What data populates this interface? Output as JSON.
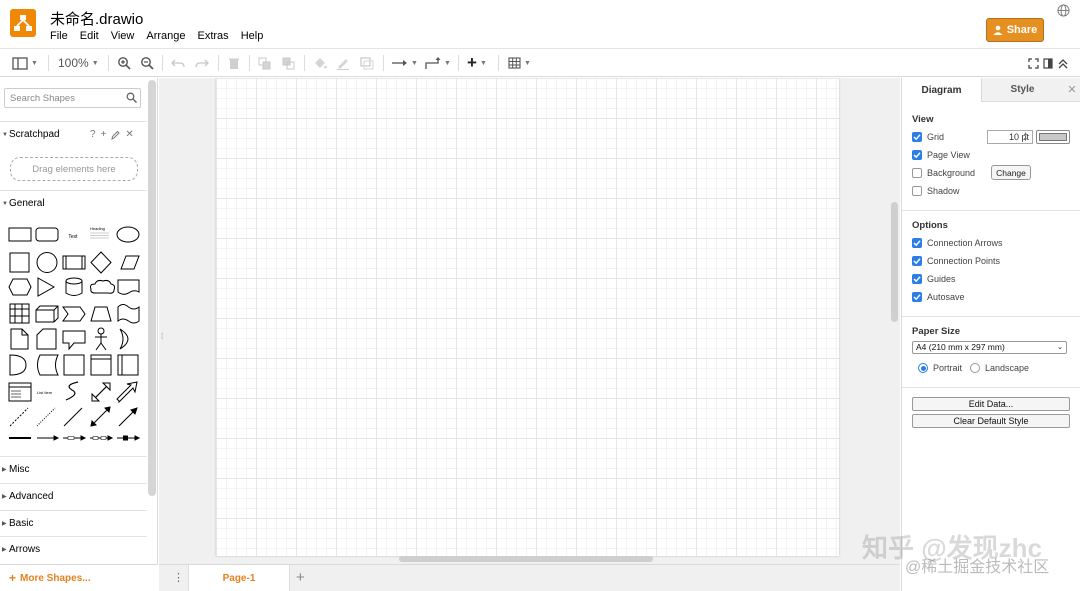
{
  "header": {
    "doc_title": "未命名.drawio",
    "menus": [
      "File",
      "Edit",
      "View",
      "Arrange",
      "Extras",
      "Help"
    ],
    "share_label": "Share"
  },
  "toolbar": {
    "zoom": "100%"
  },
  "left_panel": {
    "search_placeholder": "Search Shapes",
    "scratchpad_title": "Scratchpad",
    "scratchpad_help": "?",
    "dropzone_text": "Drag elements here",
    "general_title": "General",
    "shape_text_label": "Text",
    "shape_heading_label": "Heading",
    "shape_list_label": "List Item",
    "sections": [
      "Misc",
      "Advanced",
      "Basic",
      "Arrows"
    ],
    "more_shapes_label": "More Shapes..."
  },
  "page_tabs": {
    "current": "Page-1"
  },
  "right_panel": {
    "tabs": [
      "Diagram",
      "Style"
    ],
    "view_title": "View",
    "view_options": [
      {
        "label": "Grid",
        "checked": true
      },
      {
        "label": "Page View",
        "checked": true
      },
      {
        "label": "Background",
        "checked": false
      },
      {
        "label": "Shadow",
        "checked": false
      }
    ],
    "grid_size": "10 pt",
    "change_label": "Change",
    "options_title": "Options",
    "options": [
      {
        "label": "Connection Arrows",
        "checked": true
      },
      {
        "label": "Connection Points",
        "checked": true
      },
      {
        "label": "Guides",
        "checked": true
      },
      {
        "label": "Autosave",
        "checked": true
      }
    ],
    "paper_title": "Paper Size",
    "paper_value": "A4 (210 mm x 297 mm)",
    "orientation": [
      {
        "label": "Portrait",
        "selected": true
      },
      {
        "label": "Landscape",
        "selected": false
      }
    ],
    "edit_data_label": "Edit Data...",
    "clear_style_label": "Clear Default Style"
  },
  "watermark": {
    "line1": "知乎 @发现zhc",
    "line2": "@稀土掘金技术社区"
  },
  "colors": {
    "accent": "#f08705",
    "share": "#e69022",
    "checkbox": "#2b7de9",
    "more_shapes": "#e6821e"
  }
}
